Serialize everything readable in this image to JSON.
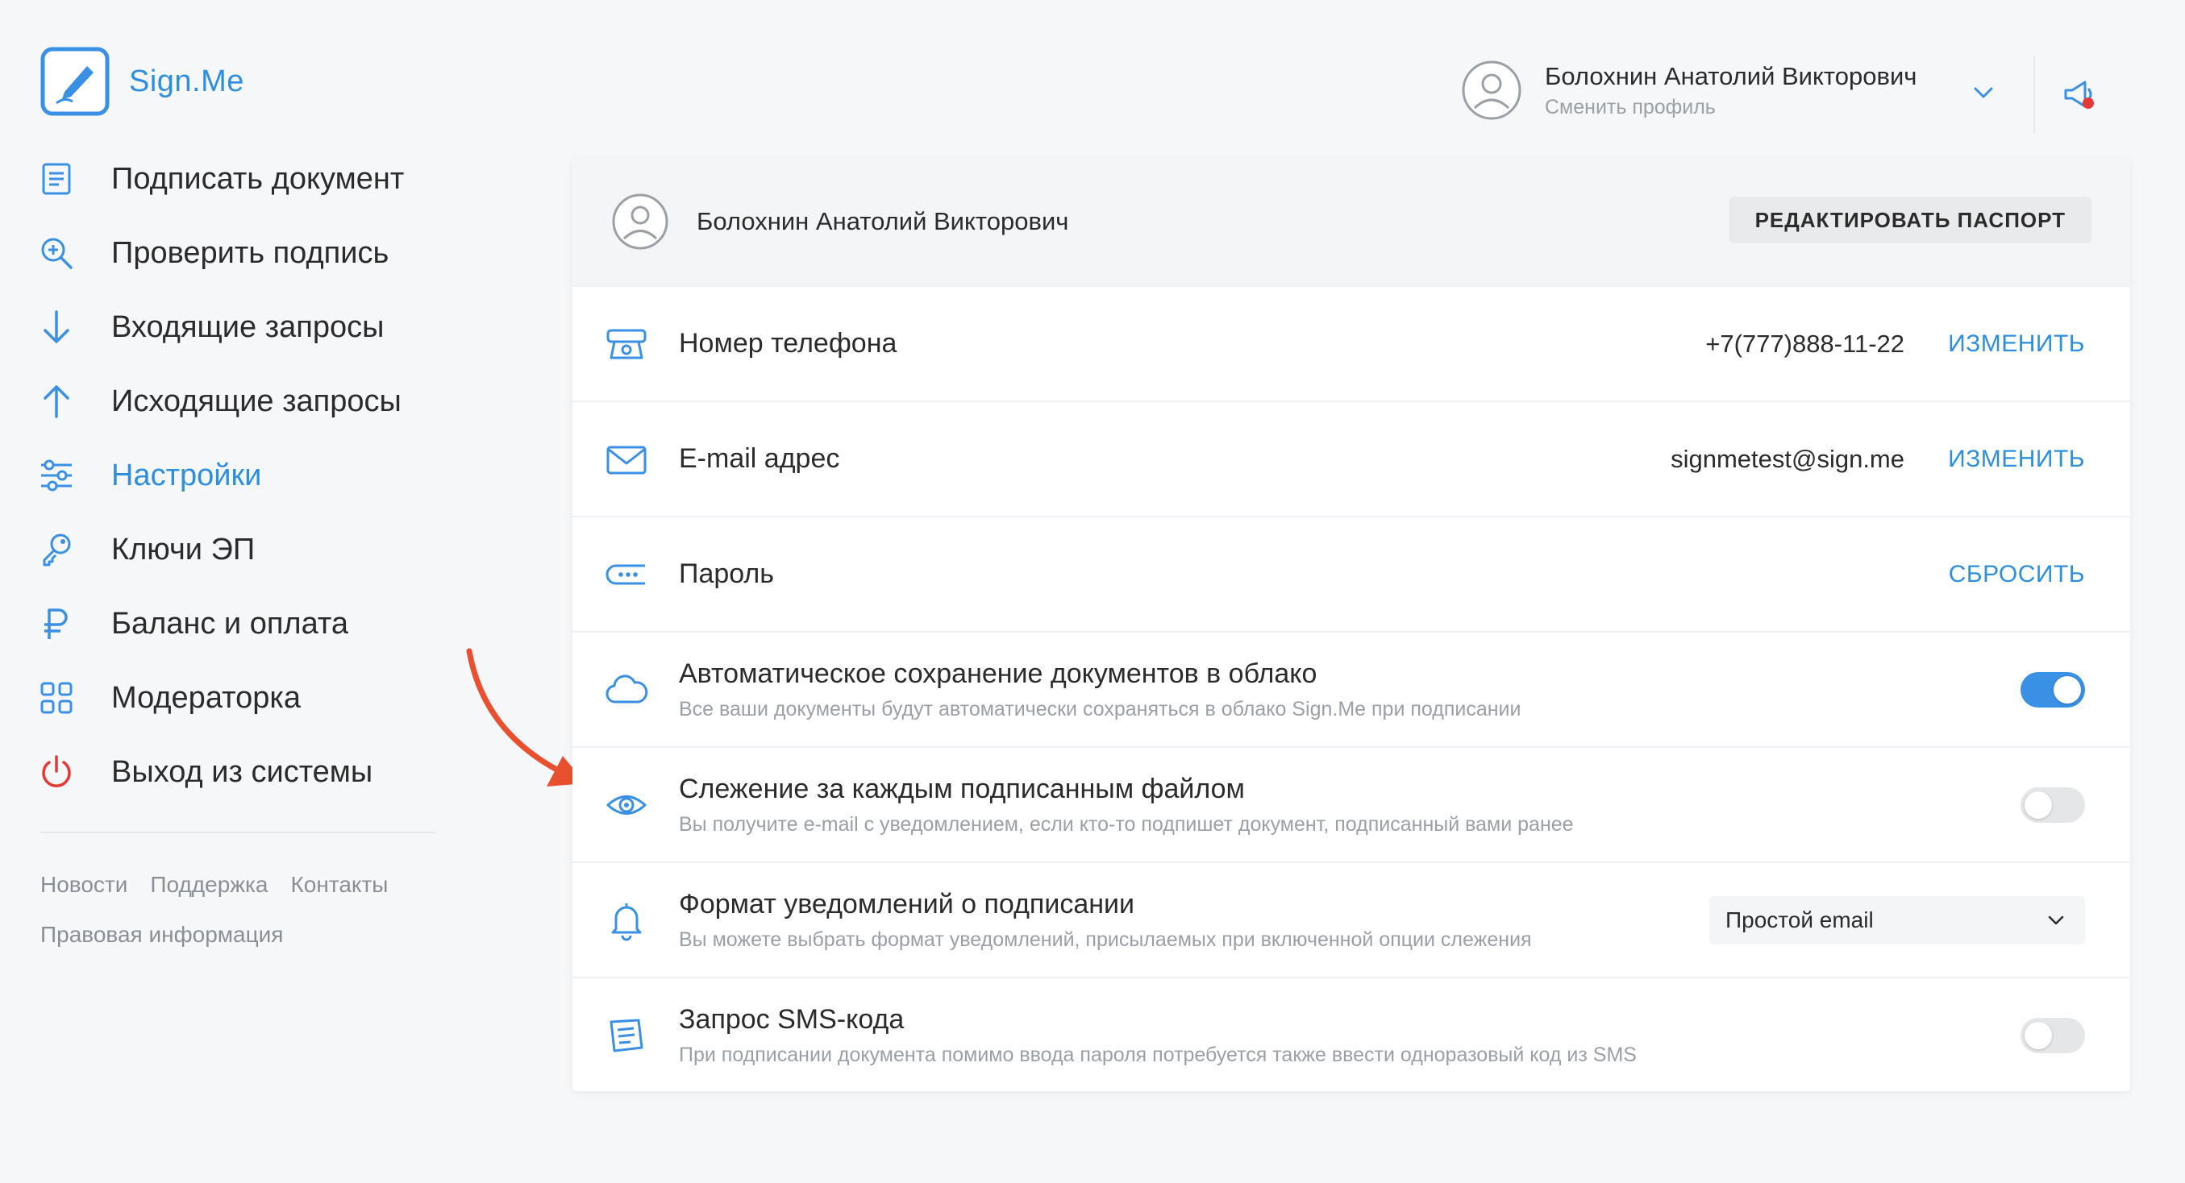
{
  "app": {
    "brand": "Sign.Me"
  },
  "sidebar": {
    "items": [
      {
        "label": "Подписать документ",
        "icon": "document-icon"
      },
      {
        "label": "Проверить подпись",
        "icon": "search-plus-icon"
      },
      {
        "label": "Входящие запросы",
        "icon": "arrow-down-icon"
      },
      {
        "label": "Исходящие запросы",
        "icon": "arrow-up-icon"
      },
      {
        "label": "Настройки",
        "icon": "sliders-icon",
        "active": true
      },
      {
        "label": "Ключи ЭП",
        "icon": "key-icon"
      },
      {
        "label": "Баланс и оплата",
        "icon": "ruble-icon"
      },
      {
        "label": "Модераторка",
        "icon": "grid-icon"
      },
      {
        "label": "Выход из системы",
        "icon": "power-icon"
      }
    ],
    "footer": {
      "news": "Новости",
      "support": "Поддержка",
      "contacts": "Контакты",
      "legal": "Правовая информация"
    }
  },
  "header": {
    "user_name": "Болохнин Анатолий Викторович",
    "switch_profile": "Сменить профиль"
  },
  "card": {
    "user_name": "Болохнин Анатолий Викторович",
    "edit_passport": "РЕДАКТИРОВАТЬ ПАСПОРТ",
    "rows": [
      {
        "title": "Номер телефона",
        "value": "+7(777)888-11-22",
        "action": "ИЗМЕНИТЬ",
        "icon": "phone-icon"
      },
      {
        "title": "E-mail адрес",
        "value": "signmetest@sign.me",
        "action": "ИЗМЕНИТЬ",
        "icon": "envelope-icon"
      },
      {
        "title": "Пароль",
        "action": "СБРОСИТЬ",
        "icon": "password-icon"
      },
      {
        "title": "Автоматическое сохранение документов в облако",
        "desc": "Все ваши документы будут автоматически сохраняться в облако Sign.Me при подписании",
        "toggle": true,
        "icon": "cloud-icon"
      },
      {
        "title": "Слежение за каждым подписанным файлом",
        "desc": "Вы получите e-mail с уведомлением, если кто-то подпишет документ, подписанный вами ранее",
        "toggle": false,
        "icon": "eye-icon"
      },
      {
        "title": "Формат уведомлений о подписании",
        "desc": "Вы можете выбрать формат уведомлений, присылаемых при включенной опции слежения",
        "select_value": "Простой email",
        "icon": "bell-icon"
      },
      {
        "title": "Запрос SMS-кода",
        "desc": "При подписании документа помимо ввода пароля потребуется также ввести одноразовый код из SMS",
        "toggle": false,
        "icon": "sms-icon"
      }
    ]
  },
  "colors": {
    "accent": "#2e8fe0",
    "annotation_arrow": "#e8502f",
    "notification_dot": "#e53935"
  }
}
